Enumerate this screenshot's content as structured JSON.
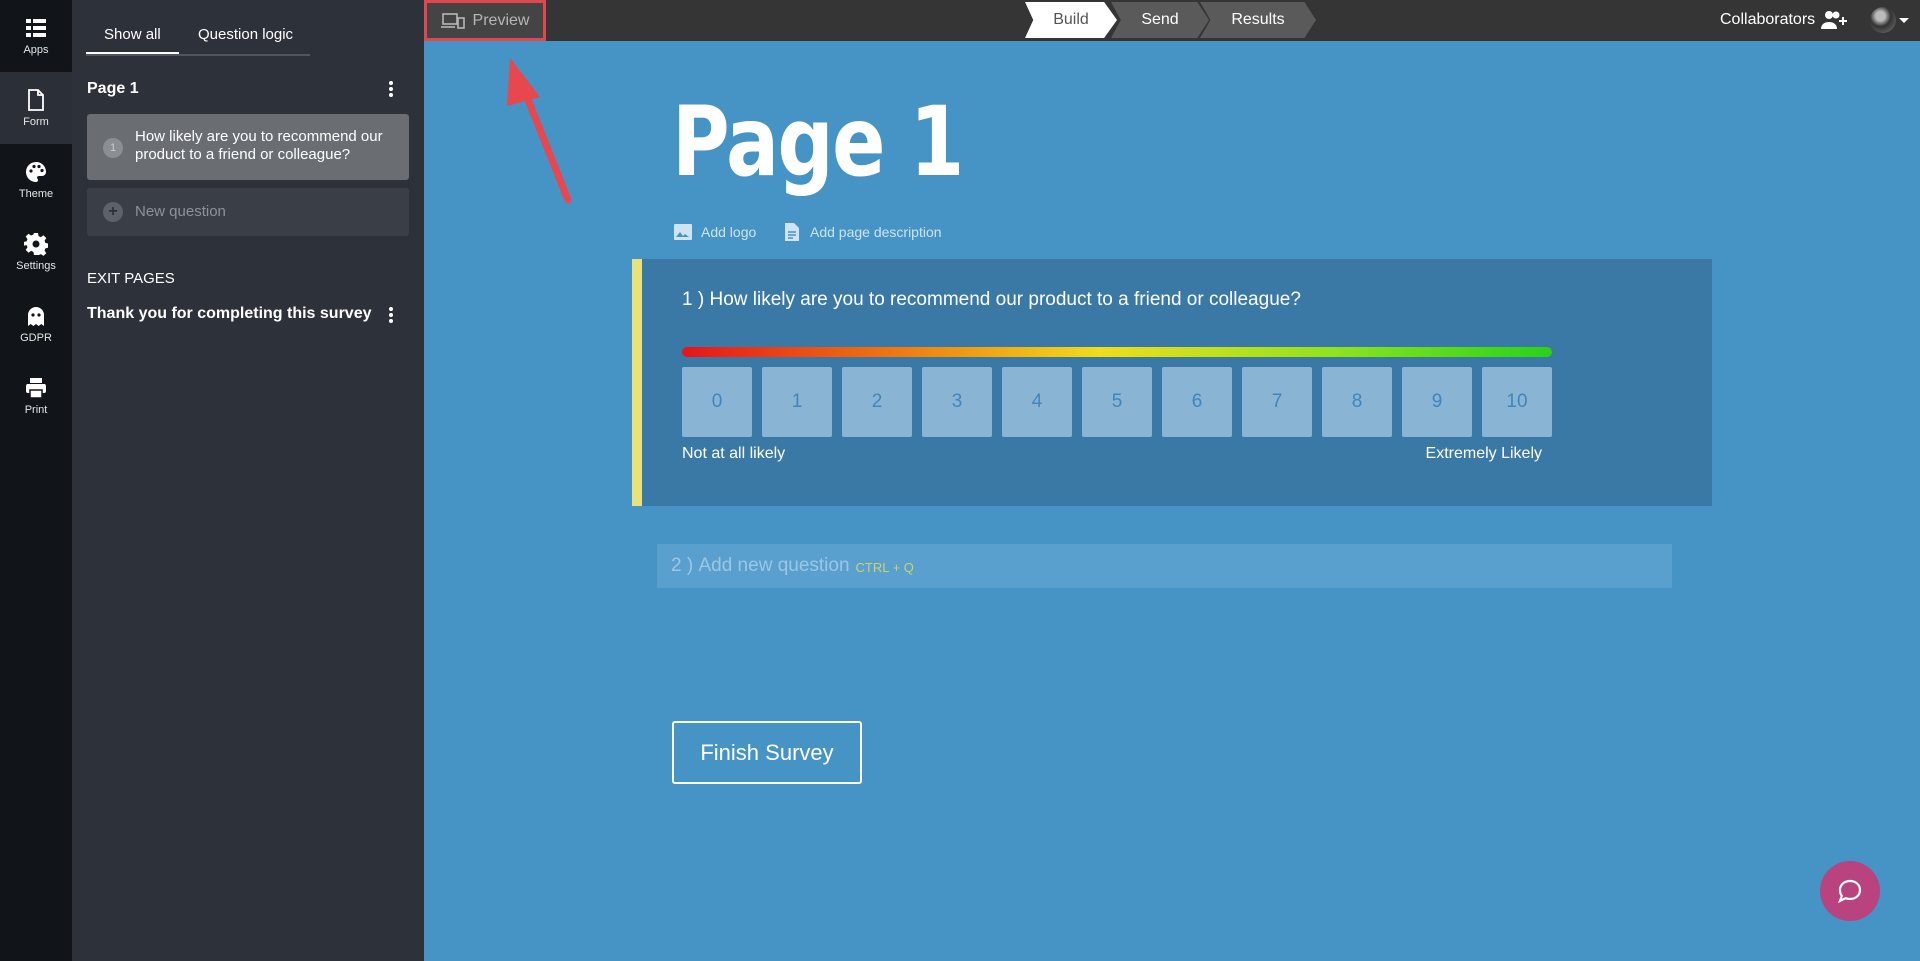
{
  "rail": [
    {
      "label": "Apps",
      "icon": "apps-grid-icon"
    },
    {
      "label": "Form",
      "icon": "form-document-icon"
    },
    {
      "label": "Theme",
      "icon": "palette-icon"
    },
    {
      "label": "Settings",
      "icon": "gear-icon"
    },
    {
      "label": "GDPR",
      "icon": "ghost-icon"
    },
    {
      "label": "Print",
      "icon": "printer-icon"
    }
  ],
  "sidebar": {
    "tabs": [
      "Show all",
      "Question logic"
    ],
    "page_heading": "Page 1",
    "question": {
      "number": "1",
      "text": "How likely are you to recommend our product to a friend or colleague?"
    },
    "new_question": "New question",
    "exit_heading": "EXIT PAGES",
    "exit_item": "Thank you for completing this survey"
  },
  "topbar": {
    "preview": "Preview",
    "steps": [
      "Build",
      "Send",
      "Results"
    ],
    "collaborators": "Collaborators"
  },
  "canvas": {
    "page_title": "Page 1",
    "add_logo": "Add logo",
    "add_description": "Add page description",
    "question": {
      "number": "1 )",
      "text": "How likely are you to recommend our product to a friend or colleague?",
      "scale": [
        "0",
        "1",
        "2",
        "3",
        "4",
        "5",
        "6",
        "7",
        "8",
        "9",
        "10"
      ],
      "label_low": "Not at all likely",
      "label_high": "Extremely Likely"
    },
    "add_question": {
      "number": "2 )",
      "text": "Add new question",
      "shortcut": "CTRL + Q"
    },
    "finish_button": "Finish Survey"
  },
  "colors": {
    "canvas_bg": "#4693c6",
    "question_block": "#3a79a6",
    "highlight_border": "#e0474f",
    "chat_button": "#b8437e"
  }
}
